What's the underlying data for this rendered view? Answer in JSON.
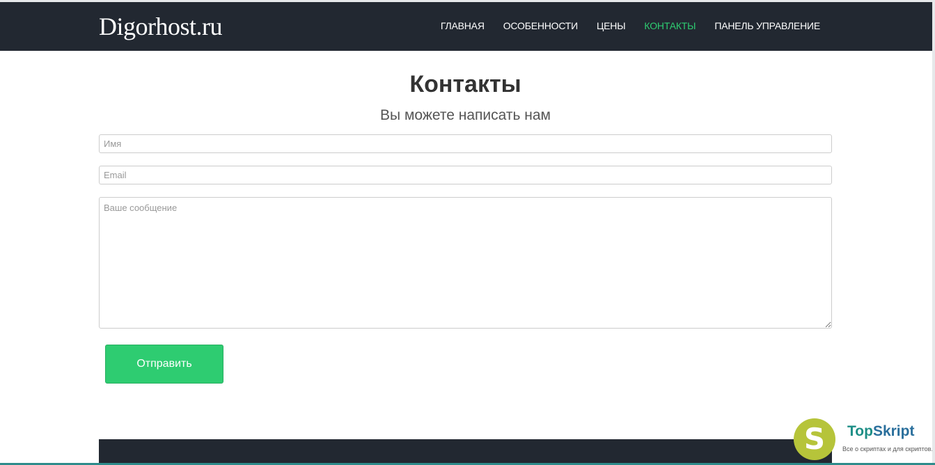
{
  "header": {
    "brand": "Digorhost.ru",
    "nav": [
      {
        "label": "ГЛАВНАЯ"
      },
      {
        "label": "ОСОБЕННОСТИ"
      },
      {
        "label": "ЦЕНЫ"
      },
      {
        "label": "КОНТАКТЫ",
        "active": true
      },
      {
        "label": "ПАНЕЛЬ УПРАВЛЕНИЕ"
      }
    ]
  },
  "contact": {
    "title": "Контакты",
    "subtitle": "Вы можете написать нам",
    "name_placeholder": "Имя",
    "email_placeholder": "Email",
    "message_placeholder": "Ваше сообщение",
    "submit_label": "Отправить"
  },
  "watermark": {
    "logo_letter": "S",
    "name_part1": "Top",
    "name_part2": "Skript",
    "tagline": "Все о скриптах и для скриптов..."
  },
  "colors": {
    "navbar_bg": "#222831",
    "accent": "#2ecc71",
    "footer_bg": "#222831",
    "watermark_logo": "#b6c43a"
  }
}
